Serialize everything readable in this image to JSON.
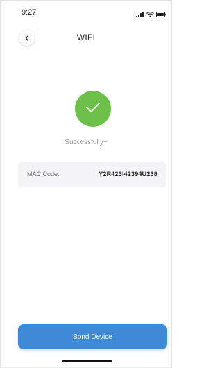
{
  "status_bar": {
    "time": "9:27",
    "icons": [
      "signal-icon",
      "wifi-icon",
      "battery-icon"
    ]
  },
  "header": {
    "title": "WIFI",
    "back_icon": "chevron-left-icon"
  },
  "result": {
    "icon": "checkmark-icon",
    "message": "Successfully~"
  },
  "mac": {
    "label": "MAC Code:",
    "value": "Y2R423I42394U238"
  },
  "bond_button": {
    "label": "Bond Device"
  },
  "colors": {
    "success_green": "#6cc04a",
    "button_blue": "#3f8ad6",
    "muted_text": "#9a9a9a"
  }
}
